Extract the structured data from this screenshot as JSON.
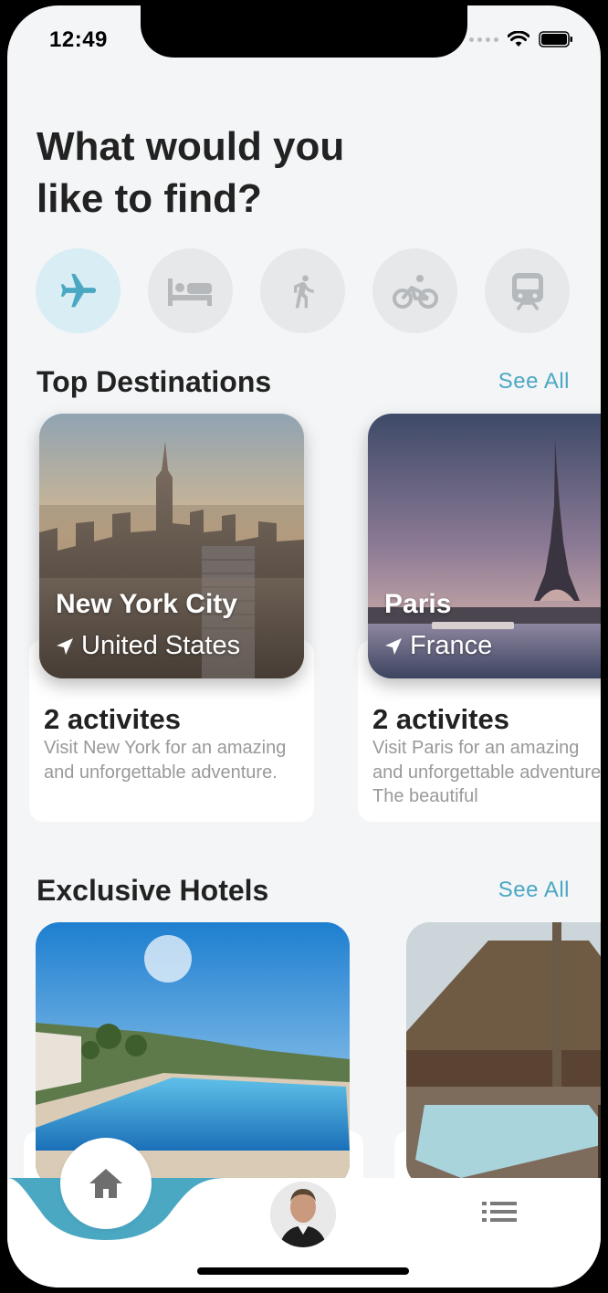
{
  "status": {
    "time": "12:49"
  },
  "header": {
    "title": "What would you\nlike to find?"
  },
  "categories": [
    {
      "icon": "airplane-icon",
      "active": true
    },
    {
      "icon": "bed-icon",
      "active": false
    },
    {
      "icon": "walking-icon",
      "active": false
    },
    {
      "icon": "bicycle-icon",
      "active": false
    },
    {
      "icon": "train-icon",
      "active": false
    }
  ],
  "top_destinations": {
    "title": "Top Destinations",
    "see_all": "See All",
    "items": [
      {
        "city": "New York City",
        "country": "United States",
        "activities": "2 activites",
        "description": "Visit New York for an amazing and unforgettable adventure."
      },
      {
        "city": "Paris",
        "country": "France",
        "activities": "2 activites",
        "description": "Visit Paris for an amazing and unforgettable adventure. The beautiful"
      }
    ]
  },
  "exclusive_hotels": {
    "title": "Exclusive Hotels",
    "see_all": "See All"
  },
  "colors": {
    "accent": "#4BA8C3",
    "accent_light": "#D8EDF4",
    "background": "#F3F5F7"
  }
}
